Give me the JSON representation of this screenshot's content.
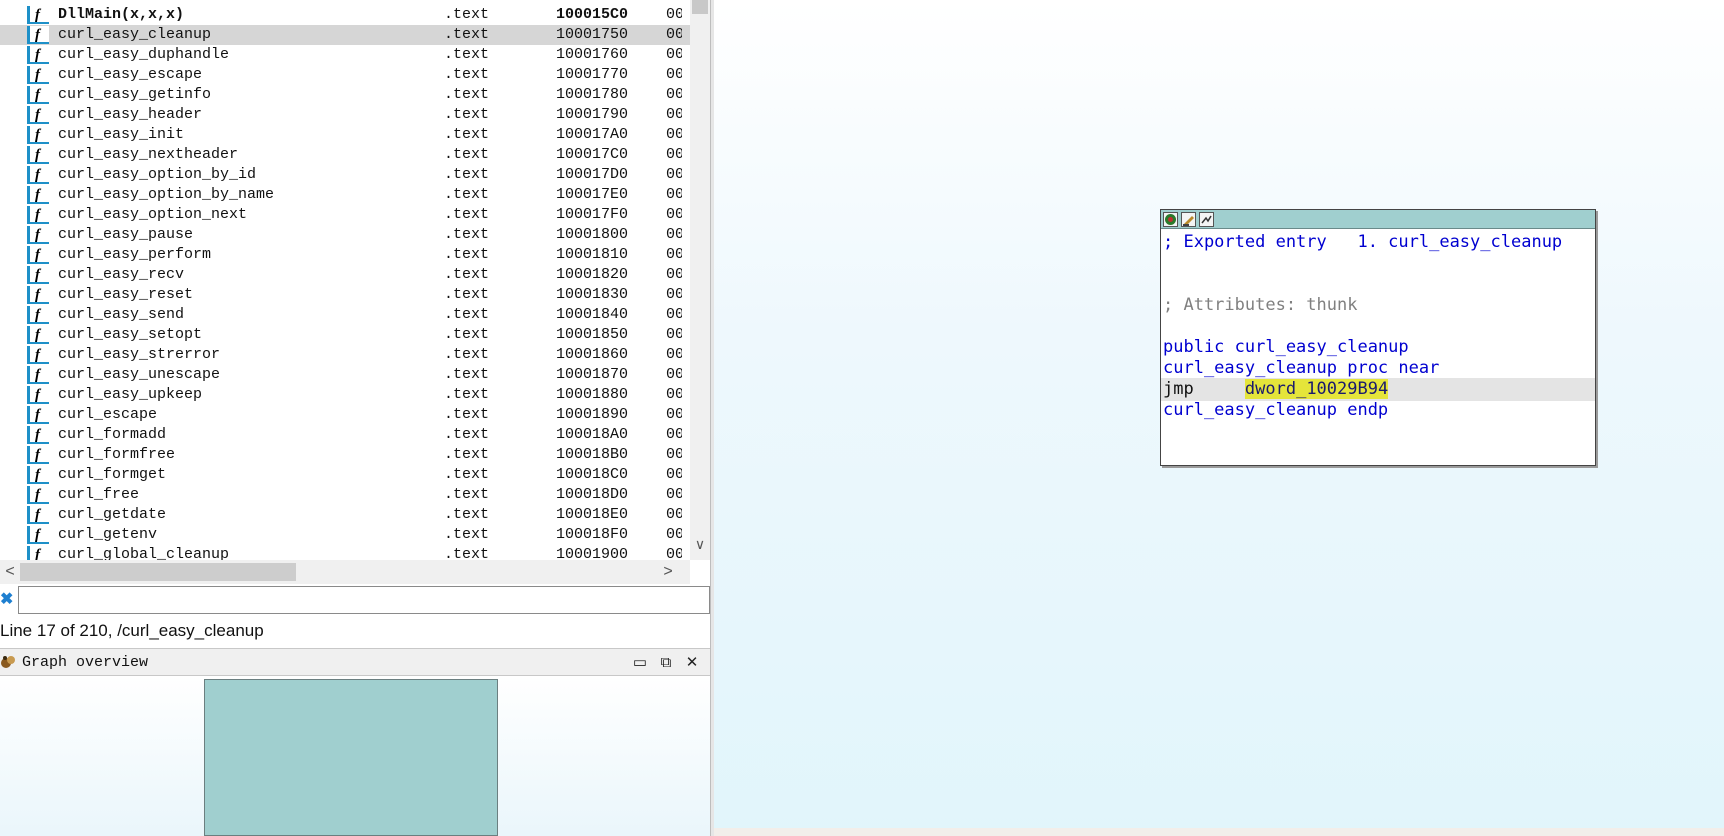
{
  "functions": [
    {
      "name": "DllMain(x,x,x)",
      "segment": ".text",
      "address": "100015C0",
      "extra": "00",
      "bold": true,
      "selected": false
    },
    {
      "name": "curl_easy_cleanup",
      "segment": ".text",
      "address": "10001750",
      "extra": "00",
      "bold": false,
      "selected": true
    },
    {
      "name": "curl_easy_duphandle",
      "segment": ".text",
      "address": "10001760",
      "extra": "00",
      "bold": false,
      "selected": false
    },
    {
      "name": "curl_easy_escape",
      "segment": ".text",
      "address": "10001770",
      "extra": "00",
      "bold": false,
      "selected": false
    },
    {
      "name": "curl_easy_getinfo",
      "segment": ".text",
      "address": "10001780",
      "extra": "00",
      "bold": false,
      "selected": false
    },
    {
      "name": "curl_easy_header",
      "segment": ".text",
      "address": "10001790",
      "extra": "00",
      "bold": false,
      "selected": false
    },
    {
      "name": "curl_easy_init",
      "segment": ".text",
      "address": "100017A0",
      "extra": "00",
      "bold": false,
      "selected": false
    },
    {
      "name": "curl_easy_nextheader",
      "segment": ".text",
      "address": "100017C0",
      "extra": "00",
      "bold": false,
      "selected": false
    },
    {
      "name": "curl_easy_option_by_id",
      "segment": ".text",
      "address": "100017D0",
      "extra": "00",
      "bold": false,
      "selected": false
    },
    {
      "name": "curl_easy_option_by_name",
      "segment": ".text",
      "address": "100017E0",
      "extra": "00",
      "bold": false,
      "selected": false
    },
    {
      "name": "curl_easy_option_next",
      "segment": ".text",
      "address": "100017F0",
      "extra": "00",
      "bold": false,
      "selected": false
    },
    {
      "name": "curl_easy_pause",
      "segment": ".text",
      "address": "10001800",
      "extra": "00",
      "bold": false,
      "selected": false
    },
    {
      "name": "curl_easy_perform",
      "segment": ".text",
      "address": "10001810",
      "extra": "00",
      "bold": false,
      "selected": false
    },
    {
      "name": "curl_easy_recv",
      "segment": ".text",
      "address": "10001820",
      "extra": "00",
      "bold": false,
      "selected": false
    },
    {
      "name": "curl_easy_reset",
      "segment": ".text",
      "address": "10001830",
      "extra": "00",
      "bold": false,
      "selected": false
    },
    {
      "name": "curl_easy_send",
      "segment": ".text",
      "address": "10001840",
      "extra": "00",
      "bold": false,
      "selected": false
    },
    {
      "name": "curl_easy_setopt",
      "segment": ".text",
      "address": "10001850",
      "extra": "00",
      "bold": false,
      "selected": false
    },
    {
      "name": "curl_easy_strerror",
      "segment": ".text",
      "address": "10001860",
      "extra": "00",
      "bold": false,
      "selected": false
    },
    {
      "name": "curl_easy_unescape",
      "segment": ".text",
      "address": "10001870",
      "extra": "00",
      "bold": false,
      "selected": false
    },
    {
      "name": "curl_easy_upkeep",
      "segment": ".text",
      "address": "10001880",
      "extra": "00",
      "bold": false,
      "selected": false
    },
    {
      "name": "curl_escape",
      "segment": ".text",
      "address": "10001890",
      "extra": "00",
      "bold": false,
      "selected": false
    },
    {
      "name": "curl_formadd",
      "segment": ".text",
      "address": "100018A0",
      "extra": "00",
      "bold": false,
      "selected": false
    },
    {
      "name": "curl_formfree",
      "segment": ".text",
      "address": "100018B0",
      "extra": "00",
      "bold": false,
      "selected": false
    },
    {
      "name": "curl_formget",
      "segment": ".text",
      "address": "100018C0",
      "extra": "00",
      "bold": false,
      "selected": false
    },
    {
      "name": "curl_free",
      "segment": ".text",
      "address": "100018D0",
      "extra": "00",
      "bold": false,
      "selected": false
    },
    {
      "name": "curl_getdate",
      "segment": ".text",
      "address": "100018E0",
      "extra": "00",
      "bold": false,
      "selected": false
    },
    {
      "name": "curl_getenv",
      "segment": ".text",
      "address": "100018F0",
      "extra": "00",
      "bold": false,
      "selected": false
    },
    {
      "name": "curl_global_cleanup",
      "segment": ".text",
      "address": "10001900",
      "extra": "00",
      "bold": false,
      "selected": false
    }
  ],
  "function_icon_glyph": "f",
  "search": {
    "close_glyph": "✖",
    "value": ""
  },
  "status_line": "Line 17 of 210, /curl_easy_cleanup",
  "graph_overview": {
    "title": "Graph overview",
    "maximize_glyph": "▭",
    "restore_glyph": "⧉",
    "close_glyph": "✕"
  },
  "scroll": {
    "down_glyph": "∨",
    "left_glyph": "<",
    "right_glyph": ">"
  },
  "graph_node": {
    "title_icons": [
      "color-icon",
      "rename-icon",
      "graph-toggle-icon"
    ],
    "lines": {
      "exported": "; Exported entry   1. curl_easy_cleanup",
      "attributes": "; Attributes: thunk",
      "public_decl": "public curl_easy_cleanup",
      "proc_decl": "curl_easy_cleanup proc near",
      "jmp_mnemonic": "jmp",
      "jmp_operand": "dword_10029B94",
      "endp": "curl_easy_cleanup endp"
    }
  },
  "colors": {
    "node_titlebar": "#a0cfcf",
    "highlight": "#e5e53a",
    "asm_blue": "#0000d0",
    "selected_row": "#d6d6d6"
  }
}
